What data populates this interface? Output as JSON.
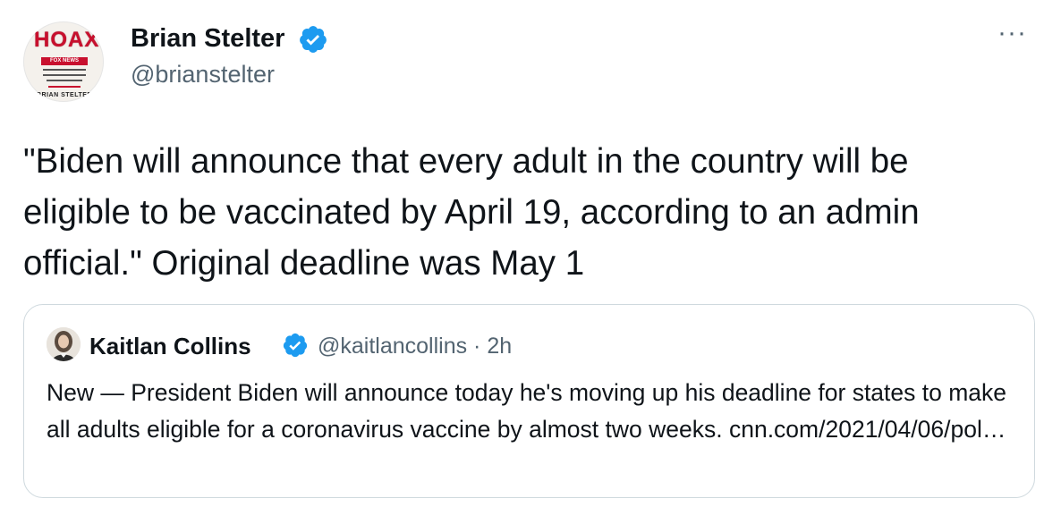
{
  "author": {
    "name": "Brian Stelter",
    "handle": "@brianstelter",
    "avatar": {
      "book_title": "HOAX",
      "band_text": "FOX NEWS",
      "author_text": "BRIAN STELTER"
    }
  },
  "tweet": {
    "text": "\"Biden will announce that every adult in the country will be eligible to be vaccinated by April 19, according to an admin official.\" Original deadline was May 1"
  },
  "menu": {
    "more_label": "···"
  },
  "quote": {
    "name": "Kaitlan Collins",
    "meta": "@kaitlancollins · 2h",
    "text": "New — President Biden will announce today he's moving up his deadline for states to make all adults eligible for a coronavirus vaccine by almost two weeks. cnn.com/2021/04/06/pol…"
  },
  "colors": {
    "verified": "#1d9bf0",
    "secondary_text": "#536471",
    "border": "#cfd9de",
    "book_red": "#c8102e"
  }
}
